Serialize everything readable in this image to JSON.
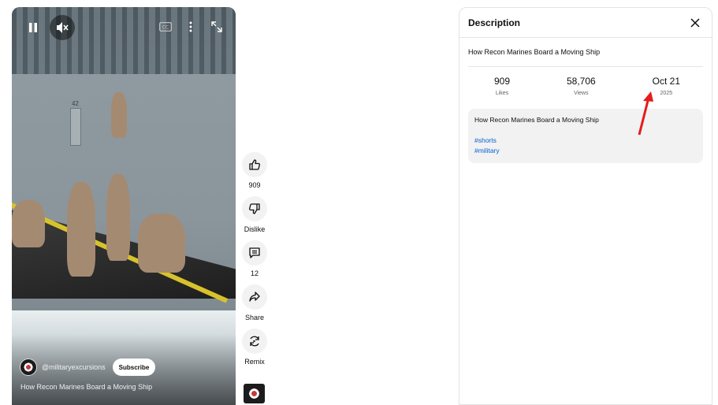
{
  "player": {
    "hull_number": "42",
    "channel_handle": "@militaryexcursions",
    "subscribe_label": "Subscribe",
    "video_title": "How Recon Marines Board a Moving Ship",
    "progress_played": 0
  },
  "actions": {
    "like_count": "909",
    "dislike_label": "Dislike",
    "comments_count": "12",
    "share_label": "Share",
    "remix_label": "Remix"
  },
  "description": {
    "header": "Description",
    "title": "How Recon Marines Board a Moving Ship",
    "stats": [
      {
        "value": "909",
        "label": "Likes"
      },
      {
        "value": "58,706",
        "label": "Views"
      },
      {
        "value": "Oct 21",
        "label": "2025"
      }
    ],
    "body_title": "How Recon Marines Board a Moving Ship",
    "tags": [
      "#shorts",
      "#military"
    ]
  },
  "colors": {
    "link": "#065fd4",
    "annotation_arrow": "#e41c1c",
    "rail_yellow": "#d8c22c"
  }
}
